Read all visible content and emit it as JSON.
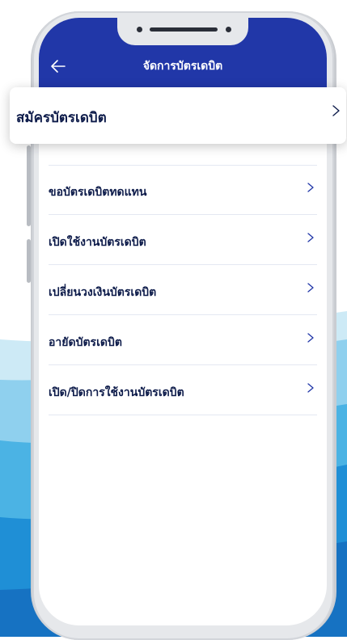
{
  "app_bar": {
    "title": "จัดการบัตรเดบิต",
    "back_icon": "arrow-left-icon",
    "color": "#2137a8"
  },
  "highlighted_item": {
    "label": "สมัครบัตรเดบิต",
    "chevron_icon": "chevron-right-icon"
  },
  "menu": {
    "items": [
      {
        "label": "ขอบัตรเดบิตทดแทน",
        "chevron_icon": "chevron-right-icon"
      },
      {
        "label": "เปิดใช้งานบัตรเดบิต",
        "chevron_icon": "chevron-right-icon"
      },
      {
        "label": "เปลี่ยนวงเงินบัตรเดบิต",
        "chevron_icon": "chevron-right-icon"
      },
      {
        "label": "อายัดบัตรเดบิต",
        "chevron_icon": "chevron-right-icon"
      },
      {
        "label": "เปิด/ปิดการใช้งานบัตรเดบิต",
        "chevron_icon": "chevron-right-icon"
      }
    ]
  },
  "colors": {
    "text_primary": "#0d1b4a",
    "chevron": "#2137a8",
    "divider": "#e4e8f2"
  }
}
